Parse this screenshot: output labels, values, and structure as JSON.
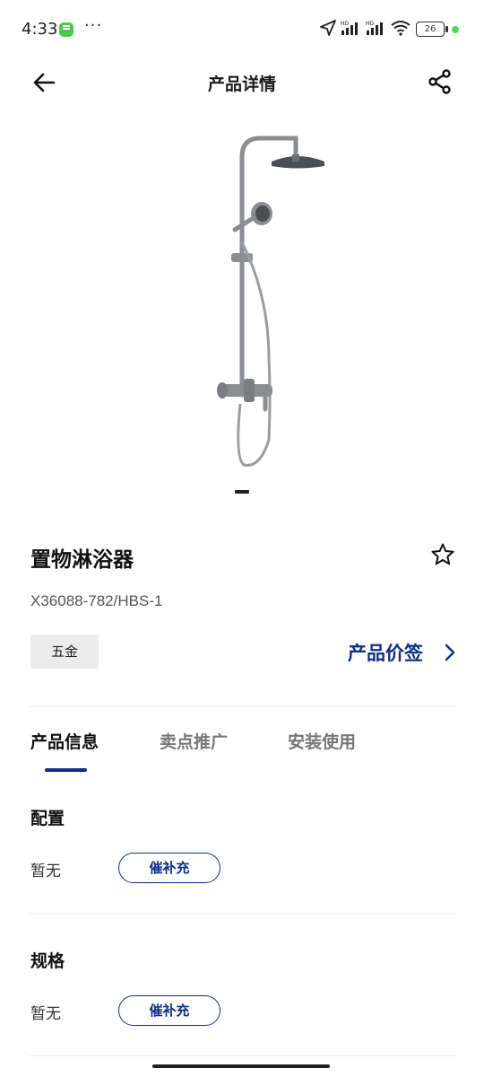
{
  "status_bar": {
    "time": "4:33",
    "dots": "···",
    "battery": "26"
  },
  "header": {
    "title": "产品详情"
  },
  "product": {
    "name": "置物淋浴器",
    "sku": "X36088-782/HBS-1",
    "tag": "五金",
    "price_link": "产品价签"
  },
  "tabs": [
    {
      "label": "产品信息",
      "active": true
    },
    {
      "label": "卖点推广",
      "active": false
    },
    {
      "label": "安装使用",
      "active": false
    }
  ],
  "sections": [
    {
      "title": "配置",
      "value": "暂无",
      "button": "催补充"
    },
    {
      "title": "规格",
      "value": "暂无",
      "button": "催补充"
    }
  ],
  "colors": {
    "accent": "#0d2f8a",
    "tag_bg": "#ececec"
  }
}
